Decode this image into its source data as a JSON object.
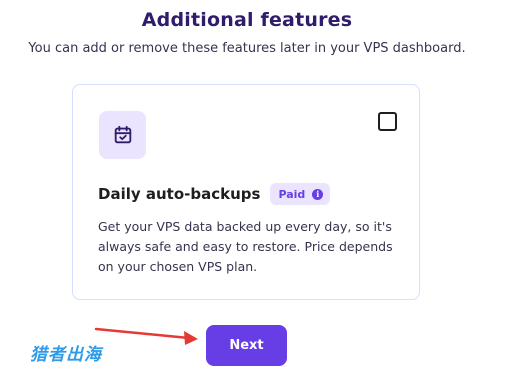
{
  "header": {
    "title": "Additional features",
    "subtitle": "You can add or remove these features later in your VPS dashboard."
  },
  "feature": {
    "icon": "calendar-check-icon",
    "name": "Daily auto-backups",
    "badge": "Paid",
    "description": "Get your VPS data backed up every day, so it's always safe and easy to restore. Price depends on your chosen VPS plan.",
    "checked": false
  },
  "actions": {
    "next_label": "Next"
  },
  "overlay": {
    "watermark_text": "猎者出海"
  },
  "colors": {
    "accent": "#673de6",
    "accent_light": "#ebe4ff",
    "title": "#2f1c6a",
    "annotation_arrow": "#e53935",
    "watermark": "#2f9be8"
  }
}
